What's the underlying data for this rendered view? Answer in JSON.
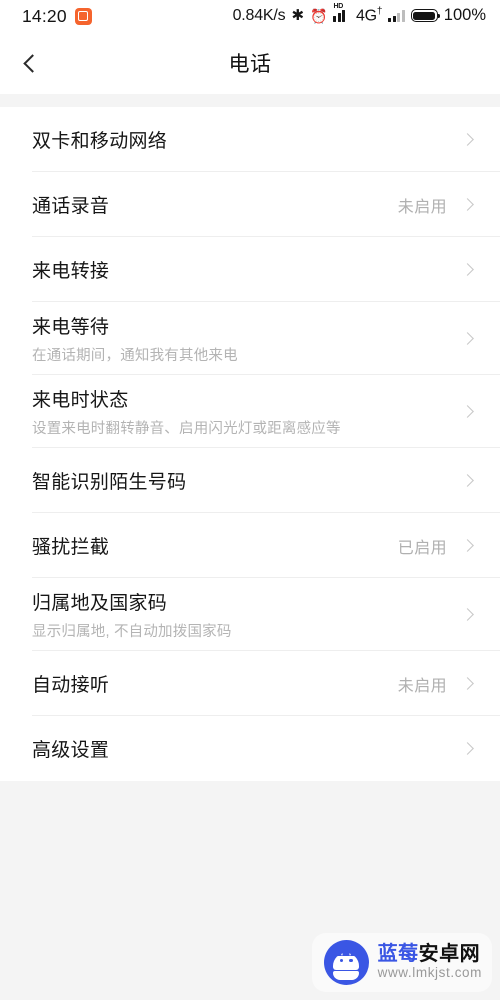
{
  "statusbar": {
    "clock": "14:20",
    "app_icon": "alarm-app-icon",
    "network_speed": "0.84K/s",
    "bluetooth_icon": "✱",
    "alarm_icon": "⏰",
    "hd_label": "HD",
    "network_type": "4G",
    "network_type_sup": "†",
    "battery_percent": "100%",
    "accent_icon_color": "#f5642d"
  },
  "header": {
    "back_icon": "chevron-left-icon",
    "title": "电话"
  },
  "list": {
    "items": [
      {
        "title": "双卡和移动网络",
        "sub": "",
        "value": ""
      },
      {
        "title": "通话录音",
        "sub": "",
        "value": "未启用"
      },
      {
        "title": "来电转接",
        "sub": "",
        "value": ""
      },
      {
        "title": "来电等待",
        "sub": "在通话期间，通知我有其他来电",
        "value": ""
      },
      {
        "title": "来电时状态",
        "sub": "设置来电时翻转静音、启用闪光灯或距离感应等",
        "value": ""
      },
      {
        "title": "智能识别陌生号码",
        "sub": "",
        "value": ""
      },
      {
        "title": "骚扰拦截",
        "sub": "",
        "value": "已启用"
      },
      {
        "title": "归属地及国家码",
        "sub": "显示归属地, 不自动加拨国家码",
        "value": ""
      },
      {
        "title": "自动接听",
        "sub": "",
        "value": "未启用"
      },
      {
        "title": "高级设置",
        "sub": "",
        "value": ""
      }
    ]
  },
  "watermark": {
    "logo_icon": "android-robot-crown-icon",
    "name_blue": "蓝莓",
    "name_black": "安卓网",
    "url": "www.lmkjst.com",
    "brand_color": "#3a56e4"
  }
}
